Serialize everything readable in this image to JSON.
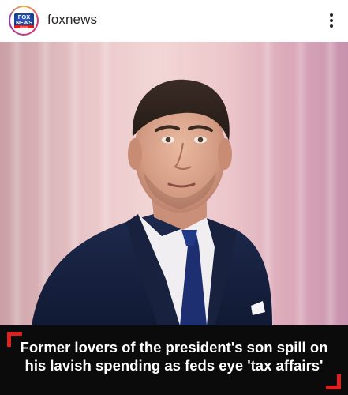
{
  "post": {
    "account": {
      "username": "foxnews",
      "avatar_logo_line1": "FOX",
      "avatar_logo_line2": "NEWS",
      "avatar_logo_line3": "channel"
    },
    "more_icon": "more-vertical-icon",
    "image": {
      "headline_line1": "Former lovers of the president's son spill on",
      "headline_line2": "his lavish spending as feds eye 'tax affairs'"
    }
  },
  "colors": {
    "accent_red": "#e02020",
    "caption_bg": "#0b0b0b",
    "fox_blue": "#1b3f9b"
  }
}
